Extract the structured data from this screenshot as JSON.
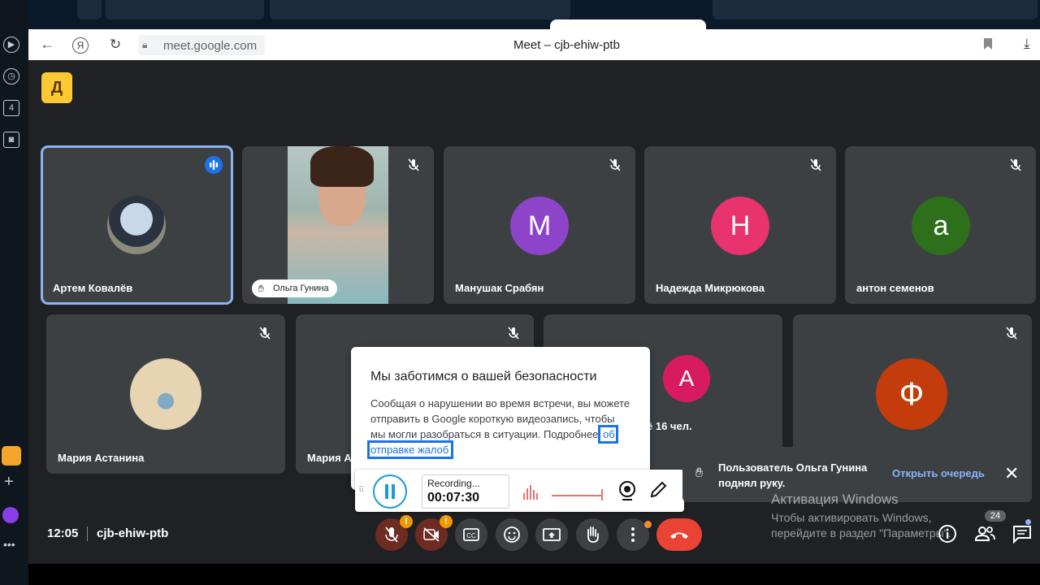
{
  "browser": {
    "url": "meet.google.com",
    "title": "Meet – cjb-ehiw-ptb"
  },
  "sidebar": {
    "badge": "4"
  },
  "app": {
    "logo_letter": "Д"
  },
  "tiles": [
    {
      "name": "Артем Ковалёв"
    },
    {
      "name": "Ольга Гунина"
    },
    {
      "name": "Манушак Срабян",
      "initial": "М",
      "color": "#8e44c9"
    },
    {
      "name": "Надежда Микрюкова",
      "initial": "Н",
      "color": "#e8336e"
    },
    {
      "name": "антон семенов",
      "initial": "а",
      "color": "#2e6f1c"
    },
    {
      "name": "Мария Астанина"
    },
    {
      "name": "Мария А"
    },
    {
      "name": "",
      "initial": "А",
      "color": "#d81b60",
      "extra": "ё 16 чел."
    },
    {
      "name": "",
      "initial": "Ф",
      "color": "#c43c0c"
    }
  ],
  "dialog": {
    "title": "Мы заботимся о вашей безопасности",
    "body": "Сообщая о нарушении во время встречи, вы можете отправить в Google короткую видеозапись, чтобы мы могли разобраться в ситуации. Подробнее",
    "link": "об отправке жалоб",
    "tail": "."
  },
  "recorder": {
    "status": "Recording...",
    "time": "00:07:30"
  },
  "notification": {
    "text": "Пользователь Ольга Гунина поднял руку.",
    "action": "Открыть очередь"
  },
  "watermark": {
    "title": "Активация Windows",
    "text": "Чтобы активировать Windows, перейдите в раздел \"Параметры\"."
  },
  "bottom": {
    "time": "12:05",
    "meeting_code": "cjb-ehiw-ptb",
    "people_count": "24",
    "warn": "!"
  },
  "colors": {
    "accent": "#1a73e8",
    "danger": "#ea4335",
    "logo": "#fcc934"
  }
}
